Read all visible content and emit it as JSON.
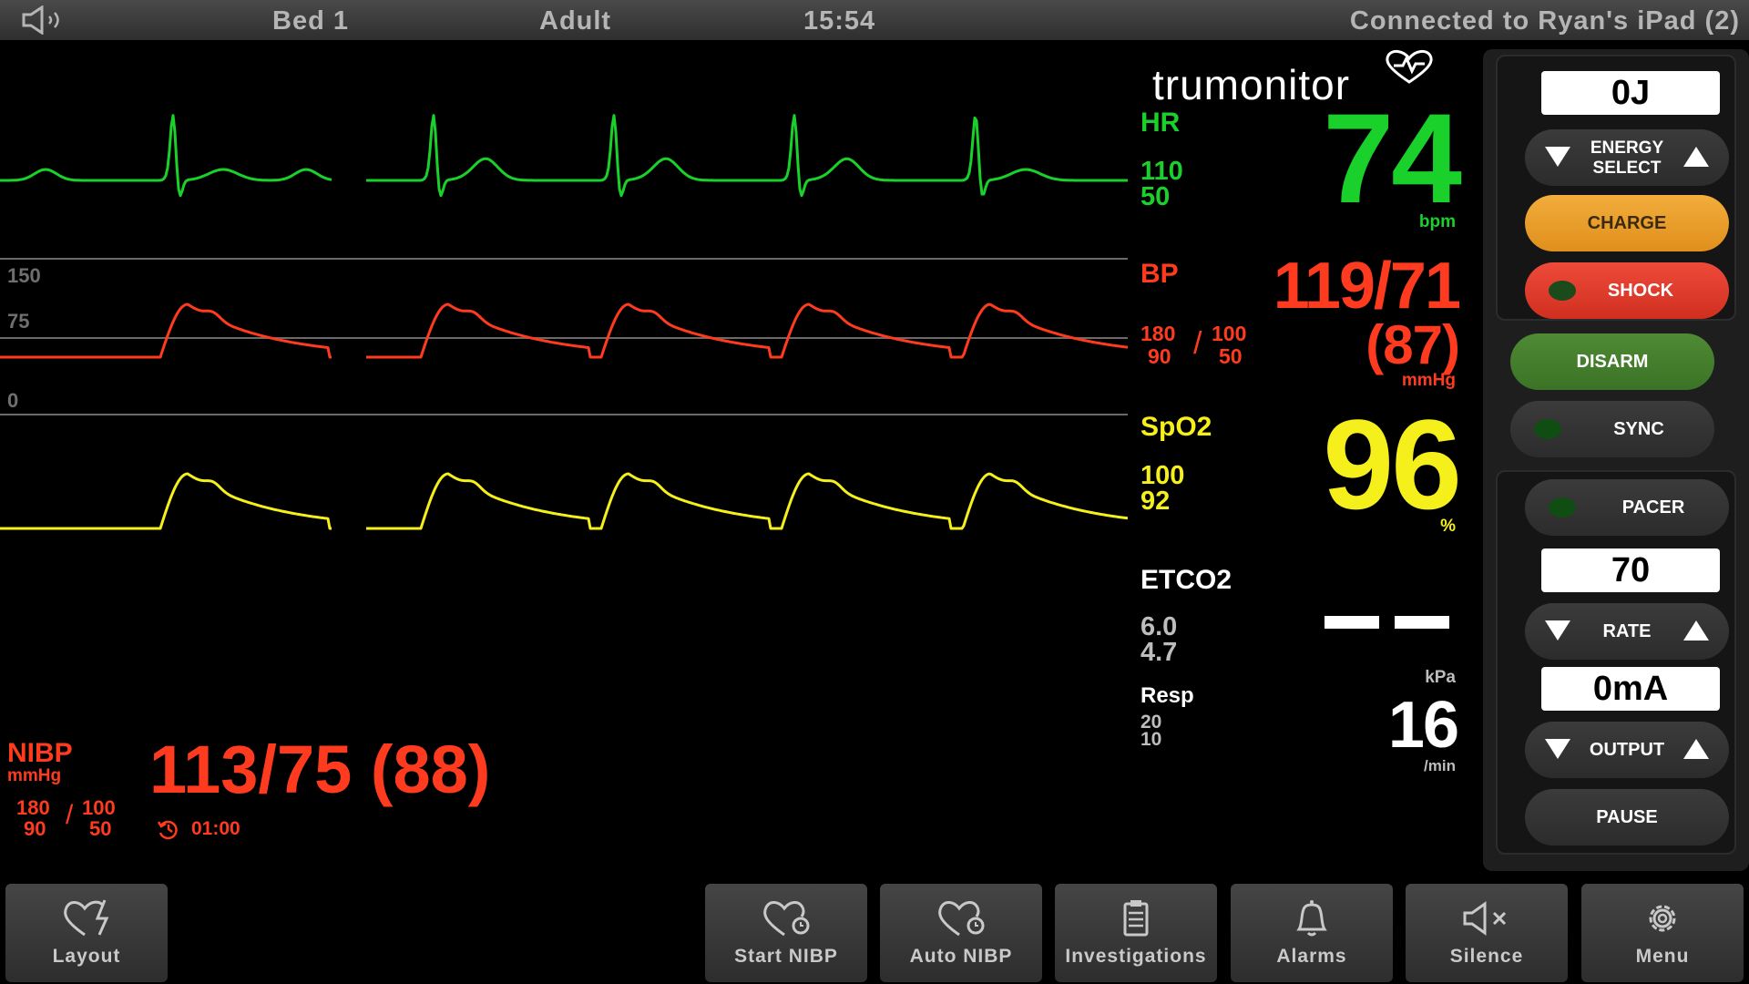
{
  "status_bar": {
    "bed": "Bed 1",
    "patient_type": "Adult",
    "time": "15:54",
    "connection": "Connected to Ryan's iPad (2)"
  },
  "brand": {
    "name": "trumonitor"
  },
  "waveforms": {
    "bp_scale": {
      "top": "150",
      "mid": "75",
      "bottom": "0"
    },
    "colors": {
      "ecg": "#19d12a",
      "bp": "#ff3b1f",
      "spo2": "#f5ef1b"
    }
  },
  "hr": {
    "label": "HR",
    "value": "74",
    "unit": "bpm",
    "alarm_high": "110",
    "alarm_low": "50",
    "color": "#19d12a"
  },
  "bp": {
    "label": "BP",
    "value": "119/71",
    "mean": "(87)",
    "unit": "mmHg",
    "sys_high": "180",
    "sys_low": "90",
    "dia_high": "100",
    "dia_low": "50",
    "color": "#ff3b1f"
  },
  "spo2": {
    "label": "SpO2",
    "value": "96",
    "unit": "%",
    "alarm_high": "100",
    "alarm_low": "92",
    "color": "#f5ef1b"
  },
  "etco2": {
    "label": "ETCO2",
    "alarm_high": "6.0",
    "alarm_low": "4.7",
    "unit": "kPa"
  },
  "resp": {
    "label": "Resp",
    "value": "16",
    "unit": "/min",
    "alarm_high": "20",
    "alarm_low": "10"
  },
  "nibp": {
    "label": "NIBP",
    "unit": "mmHg",
    "value": "113/75 (88)",
    "sys_high": "180",
    "sys_low": "90",
    "dia_high": "100",
    "dia_low": "50",
    "interval": "01:00"
  },
  "defib": {
    "energy_display": "0J",
    "energy_label_1": "ENERGY",
    "energy_label_2": "SELECT",
    "charge": "CHARGE",
    "shock": "SHOCK",
    "disarm": "DISARM",
    "sync": "SYNC"
  },
  "pacer": {
    "pacer": "PACER",
    "rate_display": "70",
    "rate": "RATE",
    "output_display": "0mA",
    "output": "OUTPUT",
    "pause": "PAUSE"
  },
  "bottom_bar": {
    "layout": "Layout",
    "start_nibp": "Start NIBP",
    "auto_nibp": "Auto NIBP",
    "investigations": "Investigations",
    "alarms": "Alarms",
    "silence": "Silence",
    "menu": "Menu"
  },
  "icons": [
    "speaker-icon",
    "heart-icon",
    "heart-timer-icon",
    "clipboard-icon",
    "bell-icon",
    "mute-icon",
    "gear-icon",
    "timer-icon"
  ]
}
